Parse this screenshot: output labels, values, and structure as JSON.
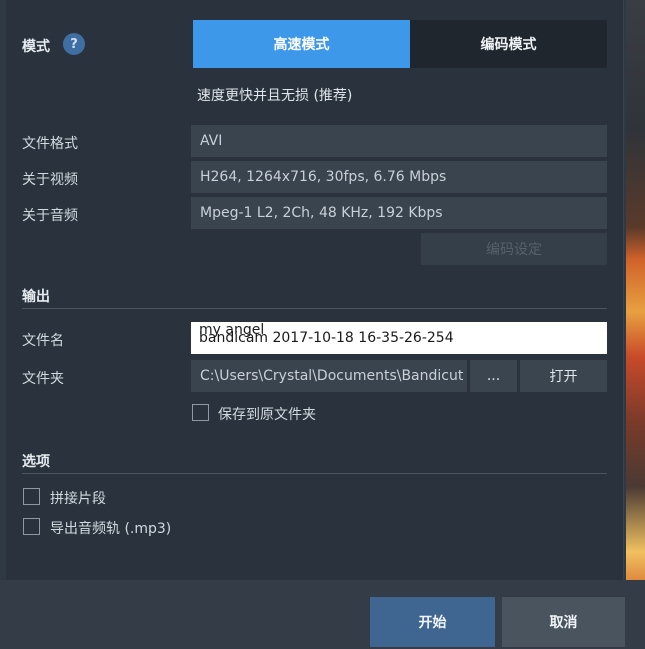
{
  "mode": {
    "label": "模式",
    "help_icon": "?",
    "tabs": [
      {
        "label": "高速模式",
        "active": true
      },
      {
        "label": "编码模式",
        "active": false
      }
    ],
    "description": "速度更快并且无损 (推荐)"
  },
  "format": {
    "file_format_label": "文件格式",
    "file_format_value": "AVI",
    "video_label": "关于视频",
    "video_value": "H264, 1264x716, 30fps, 6.76 Mbps",
    "audio_label": "关于音频",
    "audio_value": "Mpeg-1 L2, 2Ch, 48 KHz, 192 Kbps",
    "encode_settings_button": "编码设定"
  },
  "output": {
    "section_title": "输出",
    "filename_label": "文件名",
    "filename_value": "bandicam 2017-10-18 16-35-26-254",
    "filename_overlay": "my angel",
    "folder_label": "文件夹",
    "folder_value": "C:\\Users\\Crystal\\Documents\\Bandicut",
    "browse_button": "...",
    "open_button": "打开",
    "save_to_source_label": "保存到原文件夹"
  },
  "options": {
    "section_title": "选项",
    "merge_segments_label": "拼接片段",
    "export_audio_label": "导出音频轨 (.mp3)"
  },
  "footer": {
    "start_button": "开始",
    "cancel_button": "取消"
  },
  "colors": {
    "accent": "#3e98ea",
    "background": "#2a333d",
    "start_button": "#3f6690"
  }
}
